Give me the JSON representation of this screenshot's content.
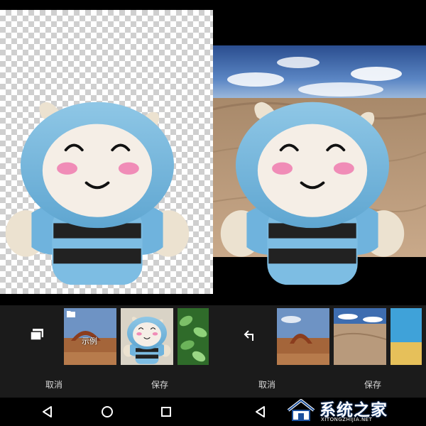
{
  "left_screen": {
    "thumbnails": [
      {
        "name": "sample-arch",
        "label": "示例"
      },
      {
        "name": "plush-doll"
      },
      {
        "name": "leaves"
      }
    ],
    "cancel_label": "取消",
    "save_label": "保存"
  },
  "right_screen": {
    "thumbnails": [
      {
        "name": "red-rock-arch"
      },
      {
        "name": "desert-dunes"
      },
      {
        "name": "beach-sky"
      }
    ],
    "cancel_label": "取消",
    "save_label": "保存"
  },
  "watermark": {
    "title": "系统之家",
    "subtitle": "XITONGZHIJIA.NET"
  },
  "icons": {
    "folder": "folder-icon",
    "undo": "undo-arrow-icon",
    "back": "back-triangle-icon",
    "home": "home-circle-icon",
    "recents": "recents-square-icon"
  }
}
